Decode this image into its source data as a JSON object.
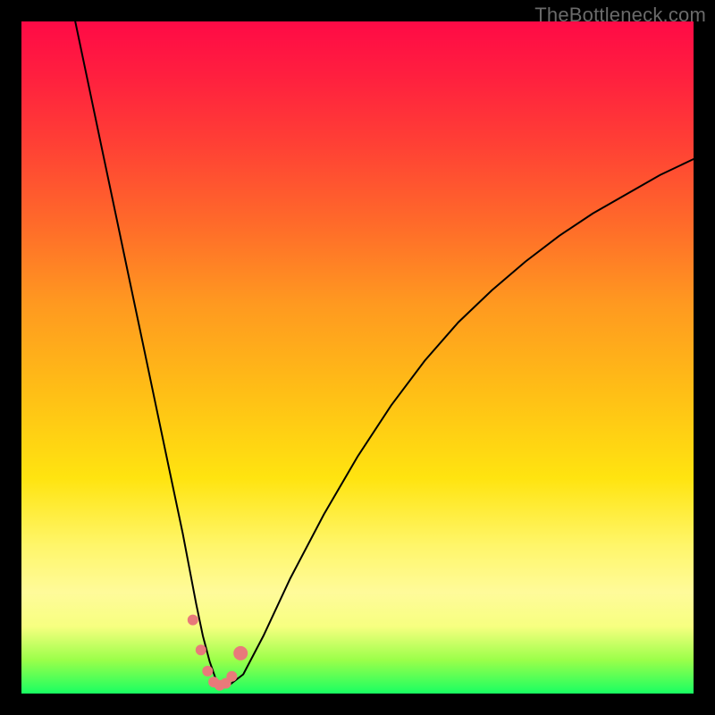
{
  "watermark": {
    "text": "TheBottleneck.com"
  },
  "colors": {
    "curve_stroke": "#000000",
    "marker_fill": "#e87a7a",
    "marker_stroke": "#c95a5a"
  },
  "chart_data": {
    "type": "line",
    "title": "",
    "xlabel": "",
    "ylabel": "",
    "xlim": [
      0,
      100
    ],
    "ylim": [
      0,
      105
    ],
    "series": [
      {
        "name": "bottleneck-curve",
        "x": [
          8,
          10,
          12,
          14,
          16,
          18,
          20,
          22,
          24,
          26,
          27,
          28,
          29,
          30,
          31,
          33,
          36,
          40,
          45,
          50,
          55,
          60,
          65,
          70,
          75,
          80,
          85,
          90,
          95,
          100
        ],
        "values": [
          105,
          95,
          85,
          75,
          65,
          55,
          45,
          35,
          25,
          14,
          9,
          5,
          2,
          1.2,
          1.4,
          3,
          9,
          18,
          28,
          37,
          45,
          52,
          58,
          63,
          67.5,
          71.5,
          75,
          78,
          81,
          83.5
        ]
      }
    ],
    "markers": {
      "x": [
        25.5,
        26.7,
        27.7,
        28.6,
        29.5,
        30.4,
        31.3,
        32.6
      ],
      "values": [
        11.5,
        6.8,
        3.5,
        1.8,
        1.3,
        1.6,
        2.7,
        6.3
      ],
      "radius": [
        6,
        6,
        6,
        6,
        6,
        6,
        6,
        8
      ]
    }
  }
}
